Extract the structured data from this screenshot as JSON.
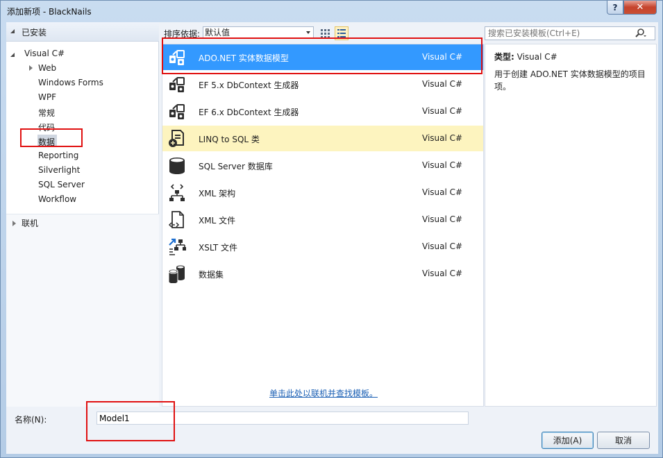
{
  "window": {
    "title": "添加新项 - BlackNails",
    "help_label": "?",
    "close_label": "✕"
  },
  "left_pane": {
    "installed_header": "已安装",
    "root_label": "Visual C#",
    "items": [
      "Web",
      "Windows Forms",
      "WPF",
      "常规",
      "代码",
      "数据",
      "Reporting",
      "Silverlight",
      "SQL Server",
      "Workflow"
    ],
    "selected_item": "数据",
    "online_label": "联机"
  },
  "toolbar": {
    "sort_label": "排序依据:",
    "sort_value": "默认值",
    "view_small_icons": "grid-view-icon",
    "view_list": "list-view-icon"
  },
  "search": {
    "placeholder": "搜索已安装模板(Ctrl+E)"
  },
  "templates": [
    {
      "name": "ADO.NET 实体数据模型",
      "lang": "Visual C#",
      "icon": "entity-model-icon",
      "state": "selected"
    },
    {
      "name": "EF 5.x DbContext 生成器",
      "lang": "Visual C#",
      "icon": "dbcontext-icon",
      "state": "normal"
    },
    {
      "name": "EF 6.x DbContext 生成器",
      "lang": "Visual C#",
      "icon": "dbcontext-icon",
      "state": "normal"
    },
    {
      "name": "LINQ to SQL 类",
      "lang": "Visual C#",
      "icon": "linq-icon",
      "state": "hover"
    },
    {
      "name": "SQL Server 数据库",
      "lang": "Visual C#",
      "icon": "database-icon",
      "state": "normal"
    },
    {
      "name": "XML 架构",
      "lang": "Visual C#",
      "icon": "xml-schema-icon",
      "state": "normal"
    },
    {
      "name": "XML 文件",
      "lang": "Visual C#",
      "icon": "xml-file-icon",
      "state": "normal"
    },
    {
      "name": "XSLT 文件",
      "lang": "Visual C#",
      "icon": "xslt-icon",
      "state": "normal"
    },
    {
      "name": "数据集",
      "lang": "Visual C#",
      "icon": "dataset-icon",
      "state": "normal"
    }
  ],
  "online_link": "单击此处以联机并查找模板。",
  "details": {
    "type_label": "类型:",
    "type_value": "Visual C#",
    "description": "用于创建 ADO.NET 实体数据模型的项目项。"
  },
  "name_field": {
    "label": "名称(N):",
    "value": "Model1"
  },
  "buttons": {
    "add": "添加(A)",
    "cancel": "取消"
  },
  "colors": {
    "selection": "#3399ff",
    "hover": "#fdf4bf",
    "annotation": "#e01010",
    "link": "#1a5fb4"
  }
}
